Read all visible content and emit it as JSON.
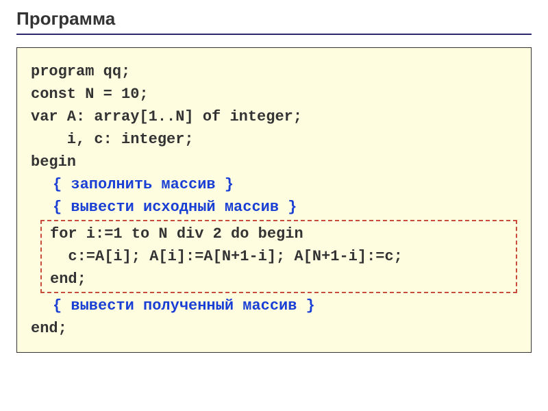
{
  "title": "Программа",
  "code": {
    "l1": "program qq;",
    "l2": "const N = 10;",
    "l3": "var A: array[1..N] of integer;",
    "l4": "    i, c: integer;",
    "l5": "begin",
    "l6": "{ заполнить массив }",
    "l7": "{ вывести исходный массив }",
    "l8": "for i:=1 to N div 2 do begin",
    "l9": "  c:=A[i]; A[i]:=A[N+1-i]; A[N+1-i]:=c;",
    "l10": "end;",
    "l11": "{ вывести полученный массив }",
    "l12": "end;"
  }
}
